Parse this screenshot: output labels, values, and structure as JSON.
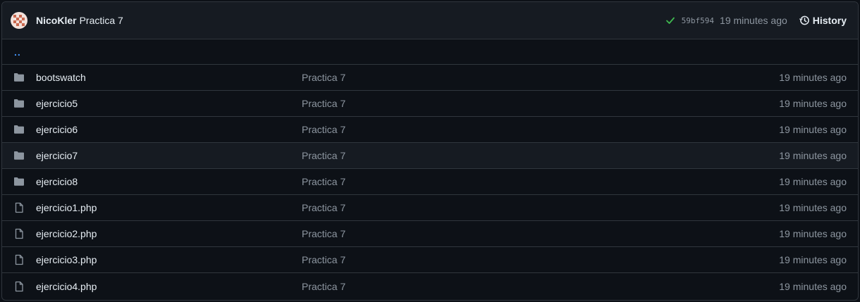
{
  "header": {
    "author": "NicoKler",
    "message": "Practica 7",
    "sha": "59bf594",
    "time": "19 minutes ago",
    "history_label": "History",
    "status_color": "#3fb950"
  },
  "parent": {
    "label": ".."
  },
  "files": [
    {
      "type": "folder",
      "name": "bootswatch",
      "commit": "Practica 7",
      "age": "19 minutes ago"
    },
    {
      "type": "folder",
      "name": "ejercicio5",
      "commit": "Practica 7",
      "age": "19 minutes ago"
    },
    {
      "type": "folder",
      "name": "ejercicio6",
      "commit": "Practica 7",
      "age": "19 minutes ago"
    },
    {
      "type": "folder",
      "name": "ejercicio7",
      "commit": "Practica 7",
      "age": "19 minutes ago"
    },
    {
      "type": "folder",
      "name": "ejercicio8",
      "commit": "Practica 7",
      "age": "19 minutes ago"
    },
    {
      "type": "file",
      "name": "ejercicio1.php",
      "commit": "Practica 7",
      "age": "19 minutes ago"
    },
    {
      "type": "file",
      "name": "ejercicio2.php",
      "commit": "Practica 7",
      "age": "19 minutes ago"
    },
    {
      "type": "file",
      "name": "ejercicio3.php",
      "commit": "Practica 7",
      "age": "19 minutes ago"
    },
    {
      "type": "file",
      "name": "ejercicio4.php",
      "commit": "Practica 7",
      "age": "19 minutes ago"
    }
  ]
}
